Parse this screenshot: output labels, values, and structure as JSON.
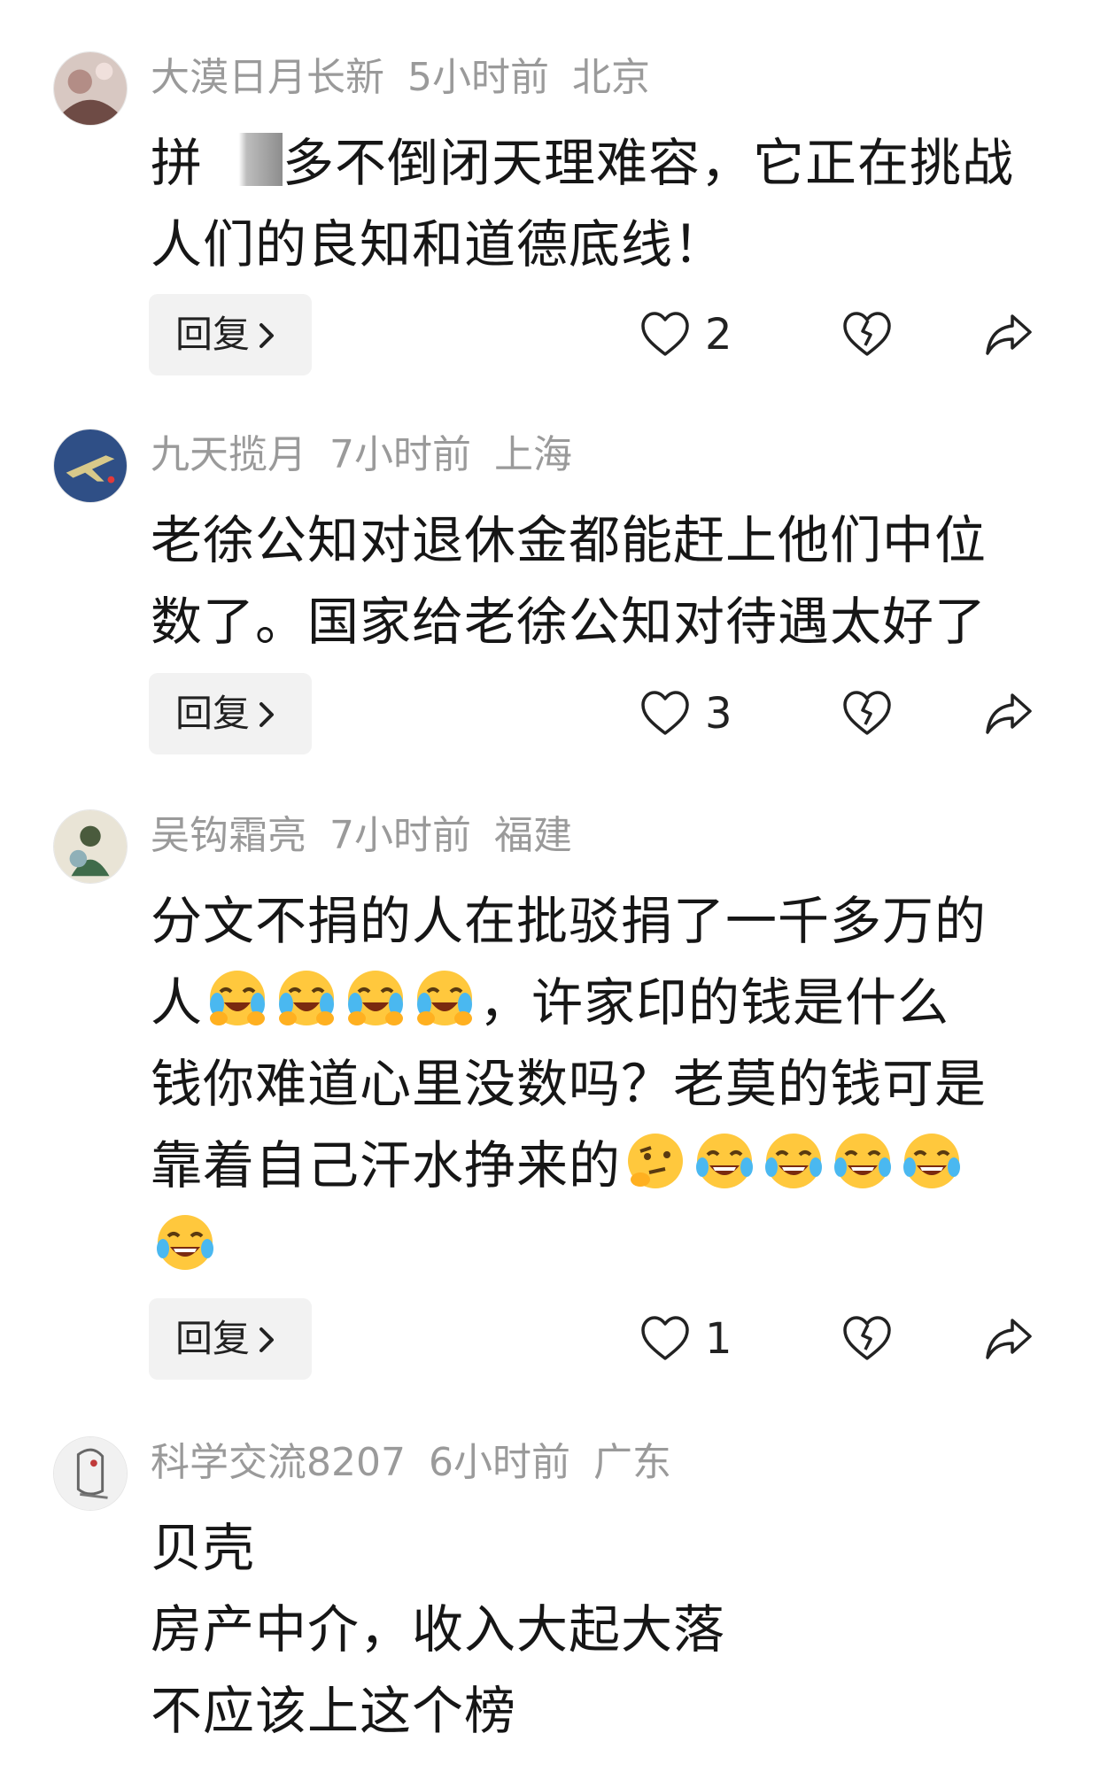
{
  "ui": {
    "reply_label": "回复"
  },
  "comments": [
    {
      "user": "大漠日月长新",
      "time": "5小时前",
      "location": "北京",
      "lines": [
        "拼",
        "多不倒闭天理难容，它正在挑战",
        "人们的良知和道德底线！"
      ],
      "likes": "2"
    },
    {
      "user": "九天揽月",
      "time": "7小时前",
      "location": "上海",
      "lines": [
        "老徐公知对退休金都能赶上他们中位",
        "数了。国家给老徐公知对待遇太好了"
      ],
      "likes": "3"
    },
    {
      "user": "吴钩霜亮",
      "time": "7小时前",
      "location": "福建",
      "lines": [
        "分文不捐的人在批驳捐了一千多万的",
        "人",
        "，许家印的钱是什么",
        "钱你难道心里没数吗？老莫的钱可是",
        "靠着自己汗水挣来的"
      ],
      "likes": "1"
    },
    {
      "user": "科学交流8207",
      "time": "6小时前",
      "location": "广东",
      "lines": [
        "贝壳",
        "房产中介，收入大起大落",
        "不应该上这个榜"
      ]
    }
  ],
  "icons": {
    "like": "heart-outline-icon",
    "dislike": "broken-heart-icon",
    "share": "share-arrow-icon",
    "emoji_cry": "crying-laughing-hands-emoji",
    "emoji_joy": "tears-of-joy-emoji",
    "emoji_think": "thinking-face-emoji"
  }
}
